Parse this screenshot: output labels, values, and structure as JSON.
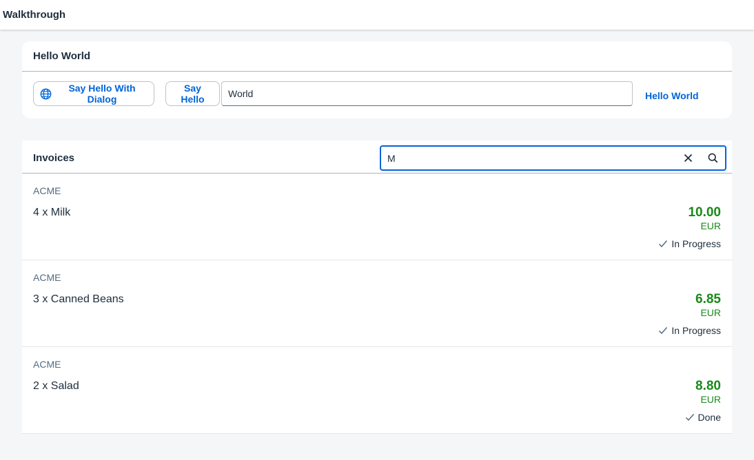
{
  "shell": {
    "title": "Walkthrough"
  },
  "panel": {
    "title": "Hello World",
    "dialog_button_label": "Say Hello With Dialog",
    "dialog_button_icon": "globe-icon",
    "hello_button_label": "Say Hello",
    "input_value": "World",
    "output_text": "Hello World"
  },
  "invoices": {
    "title": "Invoices",
    "search_value": "M",
    "items": [
      {
        "vendor": "ACME",
        "description": "4 x Milk",
        "amount": "10.00",
        "currency": "EUR",
        "status": "In Progress"
      },
      {
        "vendor": "ACME",
        "description": "3 x Canned Beans",
        "amount": "6.85",
        "currency": "EUR",
        "status": "In Progress"
      },
      {
        "vendor": "ACME",
        "description": "2 x Salad",
        "amount": "8.80",
        "currency": "EUR",
        "status": "Done"
      }
    ]
  },
  "colors": {
    "accent": "#0064d9",
    "positive": "#188918",
    "background": "#f5f6f7"
  }
}
